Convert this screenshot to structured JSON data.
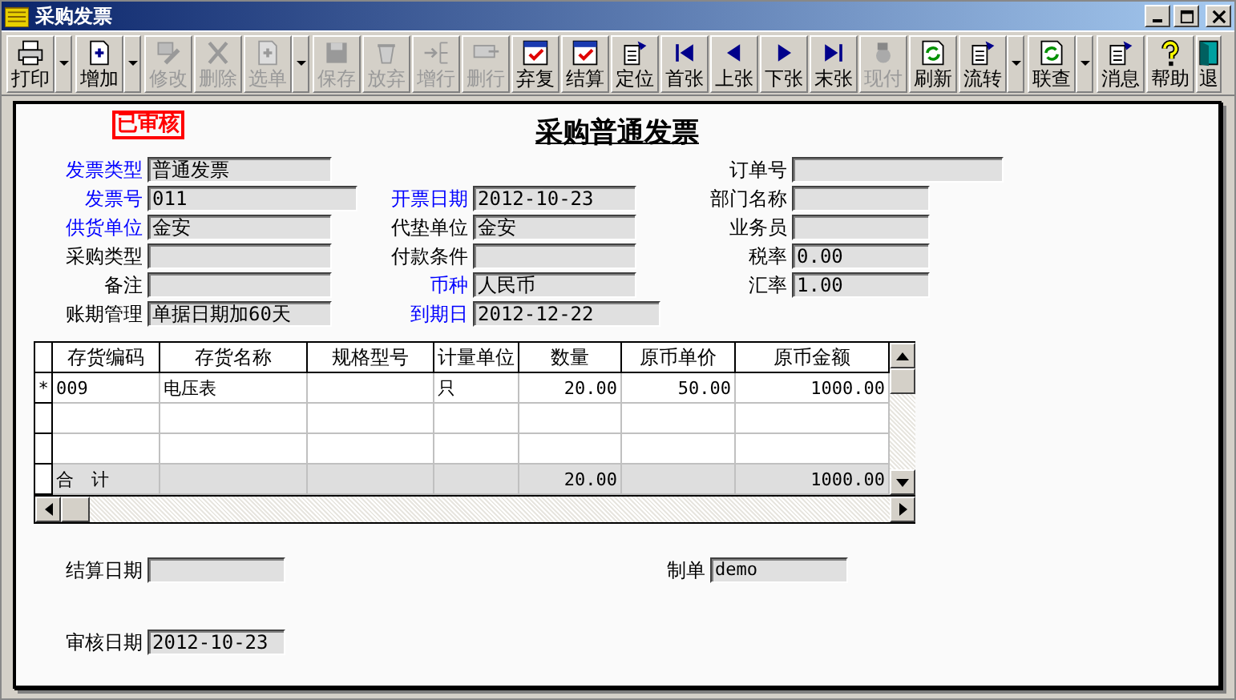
{
  "window": {
    "title": "采购发票"
  },
  "toolbar": [
    {
      "label": "打印",
      "disabled": false,
      "dropdown": true
    },
    {
      "label": "增加",
      "disabled": false,
      "dropdown": true
    },
    {
      "label": "修改",
      "disabled": true,
      "dropdown": false
    },
    {
      "label": "删除",
      "disabled": true,
      "dropdown": false
    },
    {
      "label": "选单",
      "disabled": true,
      "dropdown": true
    },
    {
      "label": "保存",
      "disabled": true,
      "dropdown": false
    },
    {
      "label": "放弃",
      "disabled": true,
      "dropdown": false
    },
    {
      "label": "增行",
      "disabled": true,
      "dropdown": false
    },
    {
      "label": "删行",
      "disabled": true,
      "dropdown": false
    },
    {
      "label": "弃复",
      "disabled": false,
      "dropdown": false
    },
    {
      "label": "结算",
      "disabled": false,
      "dropdown": false
    },
    {
      "label": "定位",
      "disabled": false,
      "dropdown": false
    },
    {
      "label": "首张",
      "disabled": false,
      "dropdown": false
    },
    {
      "label": "上张",
      "disabled": false,
      "dropdown": false
    },
    {
      "label": "下张",
      "disabled": false,
      "dropdown": false
    },
    {
      "label": "末张",
      "disabled": false,
      "dropdown": false
    },
    {
      "label": "现付",
      "disabled": true,
      "dropdown": false
    },
    {
      "label": "刷新",
      "disabled": false,
      "dropdown": false
    },
    {
      "label": "流转",
      "disabled": false,
      "dropdown": true
    },
    {
      "label": "联查",
      "disabled": false,
      "dropdown": true
    },
    {
      "label": "消息",
      "disabled": false,
      "dropdown": false
    },
    {
      "label": "帮助",
      "disabled": false,
      "dropdown": false
    },
    {
      "label": "退",
      "disabled": false,
      "dropdown": false
    }
  ],
  "form": {
    "stamp": "已审核",
    "title": "采购普通发票",
    "left_fields": [
      {
        "label": "发票类型",
        "value": "普通发票",
        "required": true
      },
      {
        "label": "发票号",
        "value": "011",
        "required": true
      },
      {
        "label": "供货单位",
        "value": "金安",
        "required": true
      },
      {
        "label": "采购类型",
        "required": false
      },
      {
        "label": "备注",
        "required": false
      },
      {
        "label": "账期管理",
        "value": "单据日期加60天",
        "required": false
      }
    ],
    "middle_fields": [
      {
        "label": "开票日期",
        "value": "2012-10-23",
        "required": true
      },
      {
        "label": "代垫单位",
        "value": "金安",
        "required": false
      },
      {
        "label": "付款条件",
        "required": false
      },
      {
        "label": "币种",
        "value": "人民币",
        "required": true
      },
      {
        "label": "到期日",
        "value": "2012-12-22",
        "required": true
      }
    ],
    "right_fields": [
      {
        "label": "订单号",
        "required": false
      },
      {
        "label": "部门名称",
        "required": false
      },
      {
        "label": "业务员",
        "required": false
      },
      {
        "label": "税率",
        "value": "0.00",
        "required": false
      },
      {
        "label": "汇率",
        "value": "1.00",
        "required": false
      }
    ],
    "table": {
      "columns": [
        "存货编码",
        "存货名称",
        "规格型号",
        "计量单位",
        "数量",
        "原币单价",
        "原币金额"
      ],
      "rows": [
        {
          "marker": "*",
          "code": "009",
          "name": "电压表",
          "unit": "只",
          "qty": "20.00",
          "price": "50.00",
          "amount": "1000.00"
        }
      ],
      "total": {
        "label": "合　计",
        "qty": "20.00",
        "amount": "1000.00"
      }
    },
    "footer_left": [
      {
        "label": "结算日期"
      },
      {
        "label": "审核日期",
        "value": "2012-10-23"
      }
    ],
    "footer_right": [
      {
        "label": "制单",
        "value": "demo"
      }
    ]
  }
}
